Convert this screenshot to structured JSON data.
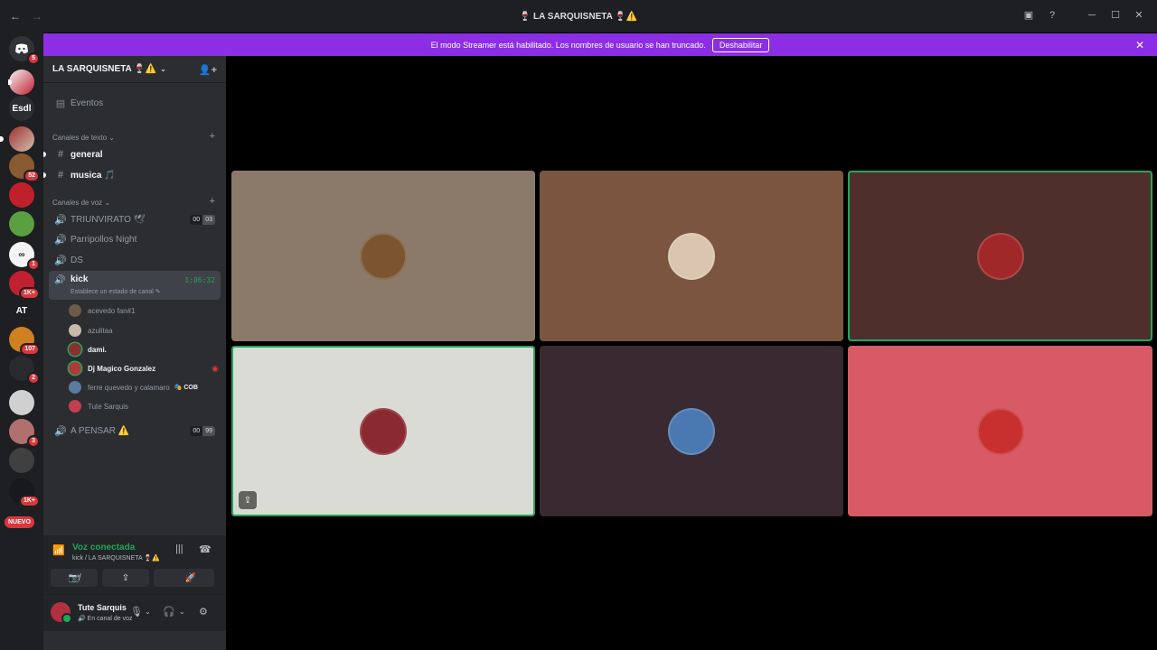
{
  "titlebar": {
    "back_icon": "←",
    "forward_icon": "→",
    "title": "🍷 LA SARQUISNETA 🍷⚠️",
    "inbox_icon": "▣",
    "help_icon": "?",
    "minimize_icon": "─",
    "maximize_icon": "☐",
    "close_icon": "✕"
  },
  "banner": {
    "message": "El modo Streamer está habilitado. Los nombres de usuario se han truncado.",
    "button": "Deshabilitar",
    "close_icon": "✕",
    "color": "#8c2ee6"
  },
  "rail": {
    "home_badge": "5",
    "text_server": "Esdl",
    "at_server": "AT",
    "badges": [
      "52",
      "1",
      "1K+",
      "107",
      "2",
      "3",
      "1K+"
    ],
    "new_label": "NUEVO"
  },
  "server": {
    "name": "LA SARQUISNETA 🍷⚠️",
    "chevron": "⌄",
    "invite_icon": "👤+"
  },
  "events": {
    "label": "Eventos",
    "icon": "▤"
  },
  "text_category": {
    "label": "Canales de texto ⌄",
    "plus": "+"
  },
  "text_channels": [
    {
      "name": "general",
      "icon": "#"
    },
    {
      "name": "musica 🎵",
      "icon": "#"
    }
  ],
  "voice_category": {
    "label": "Canales de voz ⌄",
    "plus": "+"
  },
  "voice_channels": [
    {
      "name": "TRIUNVIRATO 🕊",
      "count_a": "00",
      "count_b": "03",
      "icon": "🔊"
    },
    {
      "name": "Parripollos Night",
      "icon": "🔊"
    },
    {
      "name": "DS",
      "icon": "🔊"
    }
  ],
  "active_voice": {
    "name": "kick",
    "timer": "1:06:32",
    "status": "Establece un estado de canal ✎",
    "icon": "🔊",
    "members": [
      {
        "name": "acevedo fan#1",
        "color": "#6b5b4a"
      },
      {
        "name": "azulitaa",
        "color": "#c8b9a8"
      },
      {
        "name": "dami.",
        "color": "#8a3030"
      },
      {
        "name": "Dj Magico Gonzalez",
        "color": "#b03a3a",
        "live_icon": "◉"
      },
      {
        "name": "ferre quevedo y calamaro",
        "color": "#5a7aa0",
        "tag": "🎭 COB"
      },
      {
        "name": "Tute Sarquis",
        "color": "#c04050"
      }
    ]
  },
  "other_voice": {
    "name": "A PENSAR ⚠️",
    "count_a": "00",
    "count_b": "99",
    "icon": "🔊"
  },
  "voice_panel": {
    "title": "Voz conectada",
    "subtitle": "kick / LA SARQUISNETA 🍷⚠️",
    "signal_icon": "📶",
    "noise_icon": "|||",
    "disconnect_icon": "☎",
    "buttons": [
      "📷̸",
      "⇪",
      "✦",
      "🚀"
    ]
  },
  "user": {
    "name": "Tute Sarquis",
    "status": "🔊 En canal de voz",
    "mic_icon": "🎙",
    "headset_icon": "🎧",
    "settings_icon": "⚙",
    "chevron": "⌄"
  },
  "tiles": [
    {
      "bg": "#8b7a6a",
      "avatar": "#7a5530",
      "speaking": false
    },
    {
      "bg": "#7b5540",
      "avatar": "#d9c5b0",
      "speaking": false
    },
    {
      "bg": "#4e2f2c",
      "avatar": "#a02828",
      "speaking": true
    },
    {
      "bg": "#dbdbd6",
      "avatar": "#8a2a30",
      "speaking": true,
      "stream_icon": "⇪"
    },
    {
      "bg": "#382a30",
      "avatar": "#4a78b0",
      "speaking": false
    },
    {
      "bg": "#d75a66",
      "avatar": "#c83030",
      "speaking": false
    }
  ]
}
